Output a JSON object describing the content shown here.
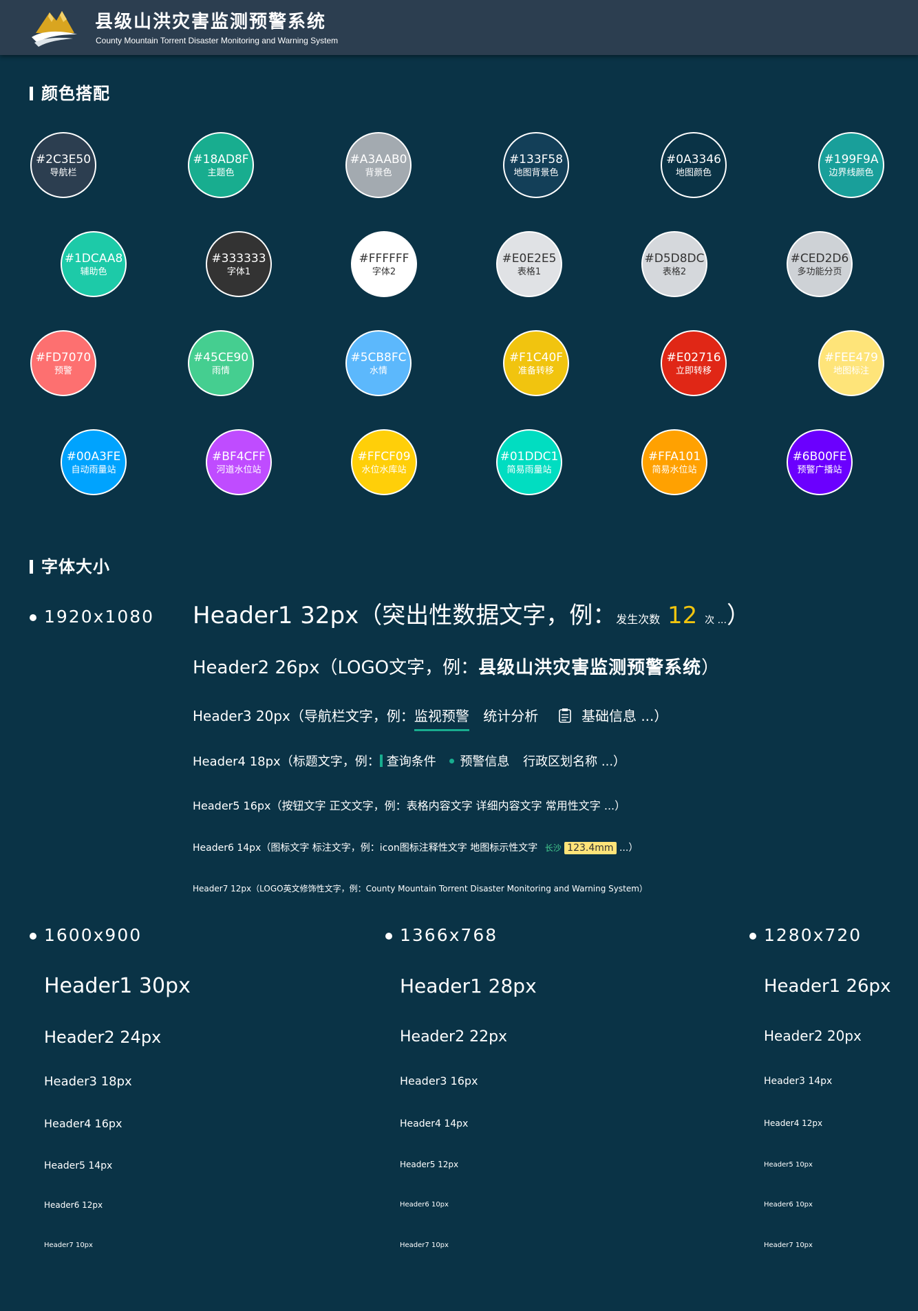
{
  "header": {
    "title": "县级山洪灾害监测预警系统",
    "subtitle": "County Mountain Torrent Disaster Monitoring and Warning System",
    "logo_icon": "mountain-logo-icon"
  },
  "colors_section": {
    "title": "颜色搭配",
    "swatches": [
      {
        "hex": "#2C3E50",
        "name": "导航栏"
      },
      {
        "hex": "#18AD8F",
        "name": "主题色"
      },
      {
        "hex": "#A3AAB0",
        "name": "背景色"
      },
      {
        "hex": "#133F58",
        "name": "地图背景色"
      },
      {
        "hex": "#0A3346",
        "name": "地图颜色"
      },
      {
        "hex": "#199F9A",
        "name": "边界线颜色"
      },
      {
        "hex": "#1DCAA8",
        "name": "辅助色"
      },
      {
        "hex": "#333333",
        "name": "字体1"
      },
      {
        "hex": "#FFFFFF",
        "name": "字体2"
      },
      {
        "hex": "#E0E2E5",
        "name": "表格1"
      },
      {
        "hex": "#D5D8DC",
        "name": "表格2"
      },
      {
        "hex": "#CED2D6",
        "name": "多功能分页"
      },
      {
        "hex": "#FD7070",
        "name": "预警"
      },
      {
        "hex": "#45CE90",
        "name": "雨情"
      },
      {
        "hex": "#5CB8FC",
        "name": "水情"
      },
      {
        "hex": "#F1C40F",
        "name": "准备转移"
      },
      {
        "hex": "#E02716",
        "name": "立即转移"
      },
      {
        "hex": "#FEE479",
        "name": "地图标注"
      },
      {
        "hex": "#00A3FE",
        "name": "自动雨量站"
      },
      {
        "hex": "#BF4CFF",
        "name": "河道水位站"
      },
      {
        "hex": "#FFCF09",
        "name": "水位水库站"
      },
      {
        "hex": "#01DDC1",
        "name": "简易雨量站"
      },
      {
        "hex": "#FFA101",
        "name": "简易水位站"
      },
      {
        "hex": "#6B00FE",
        "name": "预警广播站"
      }
    ]
  },
  "fonts_section": {
    "title": "字体大小",
    "res_1920": "1920x1080",
    "h1": {
      "label": "Header1  32px（突出性数据文字，例：",
      "small": "发生次数",
      "num": "12",
      "tail": "次 ...",
      "close": "）"
    },
    "h2": {
      "label": "Header2  26px（LOGO文字，例：",
      "bold": "县级山洪灾害监测预警系统",
      "close": "）"
    },
    "h3": {
      "label": "Header3  20px（导航栏文字，例：",
      "active": "监视预警",
      "item2": "统计分析",
      "item3": "基础信息 ...）",
      "icon": "clipboard-icon"
    },
    "h4": {
      "label": "Header4  18px（标题文字，例：",
      "item1": "查询条件",
      "item2": "预警信息",
      "item3": "行政区划名称 ...）"
    },
    "h5": {
      "label": "Header5  16px（按钮文字    正文文字，例：表格内容文字    详细内容文字    常用性文字 ...）"
    },
    "h6": {
      "label": "Header6  14px（图标文字    标注文字，例：icon图标注释性文字    地图标示性文字",
      "map_label": "长沙",
      "measure": "123.4mm",
      "tail": "...）"
    },
    "h7": {
      "label": "Header7  12px（LOGO英文修饰性文字，例：County Mountain Torrent Disaster Monitoring and Warning System）"
    },
    "resolutions": [
      {
        "name": "1600x900",
        "sizes": [
          "Header1  30px",
          "Header2  24px",
          "Header3  18px",
          "Header4  16px",
          "Header5  14px",
          "Header6  12px",
          "Header7  10px"
        ]
      },
      {
        "name": "1366x768",
        "sizes": [
          "Header1  28px",
          "Header2  22px",
          "Header3  16px",
          "Header4  14px",
          "Header5  12px",
          "Header6  10px",
          "Header7  10px"
        ]
      },
      {
        "name": "1280x720",
        "sizes": [
          "Header1  26px",
          "Header2  20px",
          "Header3  14px",
          "Header4  12px",
          "Header5  10px",
          "Header6  10px",
          "Header7  10px"
        ]
      }
    ]
  }
}
